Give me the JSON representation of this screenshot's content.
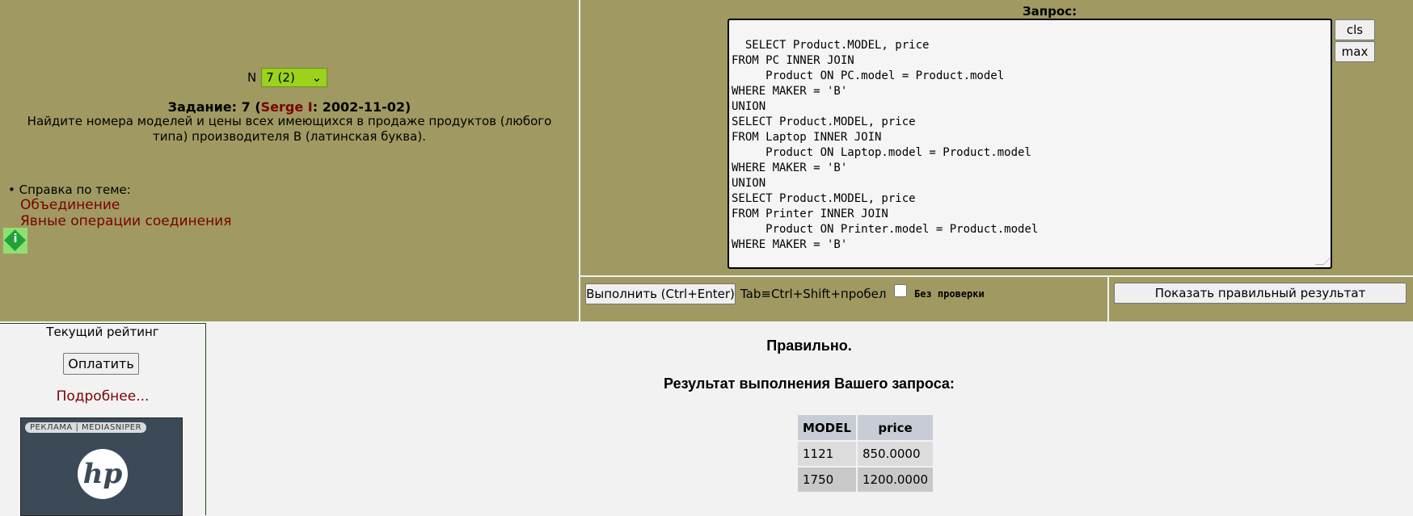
{
  "task": {
    "n_label": "N",
    "n_selected": "7 (2)",
    "title_prefix": "Задание: 7 (",
    "author": "Serge I",
    "title_suffix": ": 2002-11-02)",
    "text": "Найдите номера моделей и цены всех имеющихся в продаже продуктов (любого типа) производителя B (латинская буква)."
  },
  "help": {
    "heading": "• Справка по теме:",
    "links": [
      "Объединение",
      "Явные операции соединения"
    ],
    "icon_label": "i"
  },
  "query": {
    "label": "Запрос:",
    "sql": "SELECT Product.MODEL, price\nFROM PC INNER JOIN\n     Product ON PC.model = Product.model\nWHERE MAKER = 'B'\nUNION\nSELECT Product.MODEL, price\nFROM Laptop INNER JOIN\n     Product ON Laptop.model = Product.model\nWHERE MAKER = 'B'\nUNION\nSELECT Product.MODEL, price\nFROM Printer INNER JOIN\n     Product ON Printer.model = Product.model\nWHERE MAKER = 'B'",
    "cls_label": "cls",
    "max_label": "max"
  },
  "actions": {
    "run_label": "Выполнить (Ctrl+Enter)",
    "tab_hint": "Tab≡Ctrl+Shift+пробел",
    "nocheck_label": "Без проверки",
    "nocheck_checked": false,
    "show_result_label": "Показать правильный результат"
  },
  "rating": {
    "title": "Текущий рейтинг",
    "pay_label": "Оплатить",
    "more_label": "Подробнее...",
    "ad_tag": "РЕКЛАМА | MEDIASNIPER",
    "ad_logo": "hp"
  },
  "result": {
    "status": "Правильно.",
    "title": "Результат выполнения Вашего запроса:",
    "columns": [
      "MODEL",
      "price"
    ],
    "rows": [
      [
        "1121",
        "850.0000"
      ],
      [
        "1750",
        "1200.0000"
      ]
    ]
  },
  "colors": {
    "panel": "#a09a62",
    "select_bg": "#9ad21c",
    "link": "#7a0000",
    "header_cell": "#c8ccd4"
  }
}
